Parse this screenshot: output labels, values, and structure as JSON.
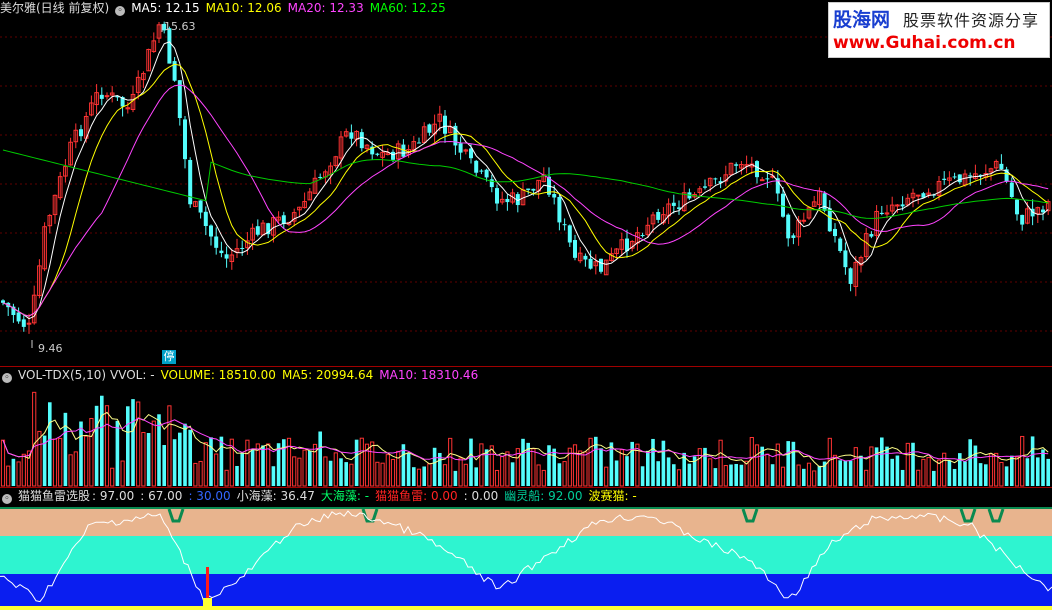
{
  "main_header": {
    "title": "美尔雅(日线 前复权)",
    "ma5_label": "MA5: 12.15",
    "ma10_label": "MA10: 12.06",
    "ma20_label": "MA20: 12.33",
    "ma60_label": "MA60: 12.25",
    "colors": {
      "title": "#dddddd",
      "ma5": "#ffffff",
      "ma10": "#ffff00",
      "ma20": "#ff00ff",
      "ma60": "#00ff00"
    }
  },
  "price_labels": {
    "high": "15.63",
    "low": "9.46",
    "limit_mark": "停"
  },
  "volume_header": {
    "title": "VOL-TDX(5,10)",
    "vvol": "VVOL: -",
    "volume": "VOLUME: 18510.00",
    "ma5": "MA5: 20994.64",
    "ma10": "MA10: 18310.46"
  },
  "indicator_header": {
    "title": "猫猫鱼雷选股",
    "v1": ": 97.00",
    "v2": ": 67.00",
    "v3": ": 30.00",
    "xiaohaizao": "小海藻: 36.47",
    "dahaizao": "大海藻: -",
    "maomao": "猫猫鱼雷: 0.00",
    "v4": ": 0.00",
    "youlingchuan": "幽灵船: 92.00",
    "bosaimao": "波赛猫: -"
  },
  "logo": {
    "name": "股海网",
    "slogan": "股票软件资源分享",
    "url": "www.Guhai.com.cn"
  },
  "colors": {
    "up": "#ff3333",
    "down": "#54fcfc",
    "bg": "#000000",
    "divider": "#a00000"
  },
  "chart_data": [
    {
      "type": "candlestick",
      "series": [
        {
          "name": "MA5",
          "values": [
            12.15
          ]
        },
        {
          "name": "MA10",
          "values": [
            12.06
          ]
        },
        {
          "name": "MA20",
          "values": [
            12.33
          ]
        },
        {
          "name": "MA60",
          "values": [
            12.25
          ]
        }
      ],
      "ylim": [
        9.46,
        15.63
      ]
    },
    {
      "type": "bar",
      "series": [
        {
          "name": "VOLUME",
          "values": [
            18510.0
          ]
        },
        {
          "name": "MA5",
          "values": [
            20994.64
          ]
        },
        {
          "name": "MA10",
          "values": [
            18310.46
          ]
        }
      ]
    }
  ]
}
